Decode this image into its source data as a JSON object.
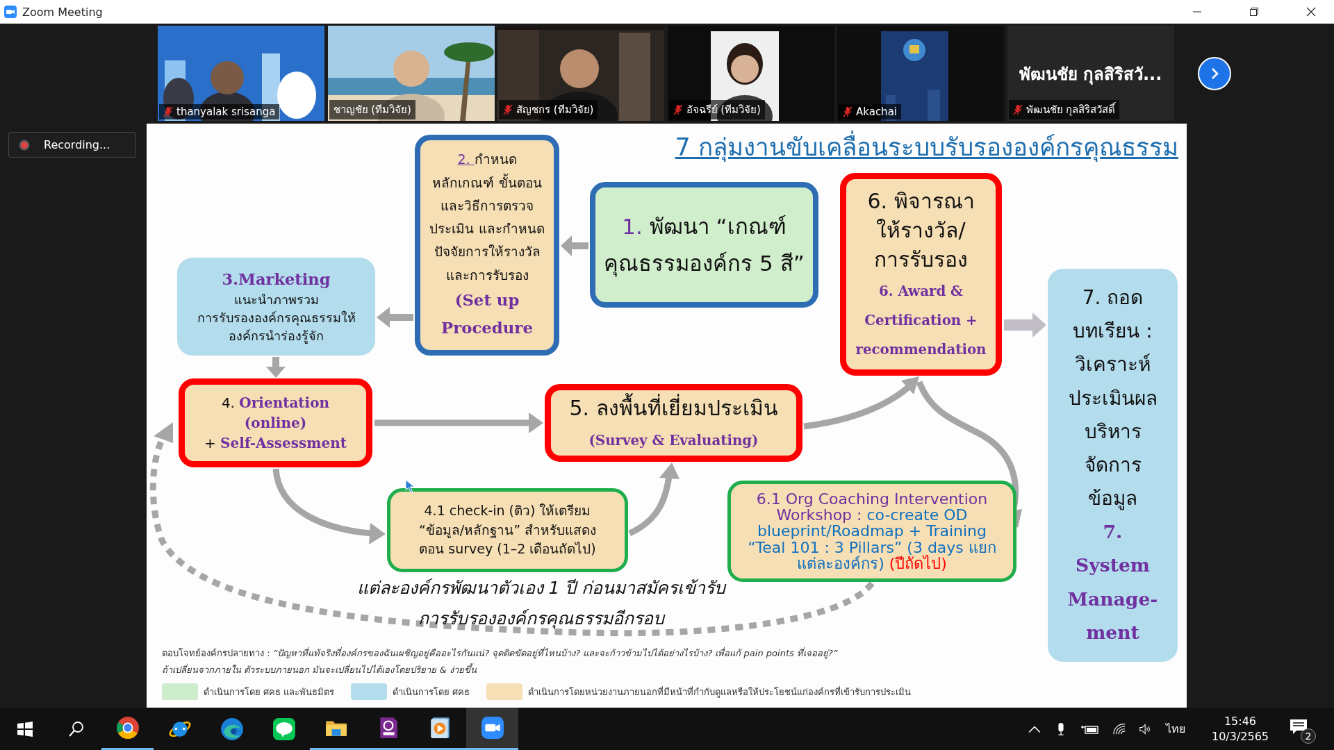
{
  "window": {
    "title": "Zoom Meeting"
  },
  "participants": [
    {
      "name": "thanyalak srisanga",
      "muted": true,
      "speaking": false,
      "kind": "video"
    },
    {
      "name": "ชาญชัย (ทีมวิจัย)",
      "muted": false,
      "speaking": true,
      "kind": "video"
    },
    {
      "name": "สัญชกร (ทีมวิจัย)",
      "muted": true,
      "speaking": false,
      "kind": "video"
    },
    {
      "name": "อัจฉรีย์ (ทีมวิจัย)",
      "muted": true,
      "speaking": false,
      "kind": "video"
    },
    {
      "name": "Akachai",
      "muted": true,
      "speaking": false,
      "kind": "video"
    },
    {
      "name": "พัฒนชัย กุลสิริสวัสดิ์",
      "display": "พัฒนชัย กุลสิริสวั...",
      "muted": true,
      "speaking": false,
      "kind": "name"
    }
  ],
  "recording": {
    "label": "Recording..."
  },
  "slide": {
    "title": "7 กลุ่มงานขับเคลื่อนระบบรับรององค์กรคุณธรรม",
    "nodes": [
      {
        "kind": "plan",
        "color": "#f6dfb4",
        "lines": [
          [
            {
              "text": "2. ",
              "kind": "link"
            },
            {
              "text": "กำหนด",
              "kind": "plain"
            }
          ],
          [
            {
              "text": "หลักเกณฑ์ ขั้นตอน",
              "kind": "plain"
            }
          ],
          [
            {
              "text": "และวิธีการตรวจ",
              "kind": "plain"
            }
          ],
          [
            {
              "text": "ประเมิน และกำหนด",
              "kind": "plain"
            }
          ],
          [
            {
              "text": "ปัจจัยการให้รางวัล",
              "kind": "plain"
            }
          ],
          [
            {
              "text": "และการรับรอง",
              "kind": "plain"
            }
          ],
          [
            {
              "text": "(Set up",
              "kind": "deco"
            }
          ],
          [
            {
              "text": "Procedure",
              "kind": "deco"
            }
          ]
        ]
      },
      {
        "kind": "plan",
        "color": "#d0eecb",
        "lines": [
          [
            {
              "text": "1. ",
              "kind": "num"
            },
            {
              "text": "พัฒนา “เกณฑ์",
              "kind": "plain"
            }
          ],
          [
            {
              "text": "คุณธรรมองค์กร 5 สี”",
              "kind": "plain"
            }
          ]
        ]
      },
      {
        "kind": "field",
        "color": "#f6dfb4",
        "lines": [
          [
            {
              "text": "6. พิจารณา",
              "kind": "plain"
            }
          ],
          [
            {
              "text": "ให้รางวัล/",
              "kind": "plain"
            }
          ],
          [
            {
              "text": "การรับรอง",
              "kind": "plain"
            }
          ],
          [
            {
              "text": "6. Award &",
              "kind": "deco"
            }
          ],
          [
            {
              "text": "Certification +",
              "kind": "deco"
            }
          ],
          [
            {
              "text": "recommendation",
              "kind": "deco"
            }
          ]
        ]
      },
      {
        "kind": "plain",
        "color": "#b3dced",
        "lines": [
          [
            {
              "text": "3.Marketing",
              "kind": "deco"
            }
          ],
          [
            {
              "text": "แนะนำภาพรวม",
              "kind": "plain"
            }
          ],
          [
            {
              "text": "การรับรององค์กรคุณธรรมให้",
              "kind": "plain"
            }
          ],
          [
            {
              "text": "องค์กรนำร่องรู้จัก",
              "kind": "plain"
            }
          ]
        ]
      },
      {
        "kind": "plain",
        "color": "#b3dced",
        "lines": [
          [
            {
              "text": "7. ถอด",
              "kind": "plain"
            }
          ],
          [
            {
              "text": "บทเรียน :",
              "kind": "plain"
            }
          ],
          [
            {
              "text": "วิเคราะห์",
              "kind": "plain"
            }
          ],
          [
            {
              "text": "ประเมินผล",
              "kind": "plain"
            }
          ],
          [
            {
              "text": "บริหาร",
              "kind": "plain"
            }
          ],
          [
            {
              "text": "จัดการ",
              "kind": "plain"
            }
          ],
          [
            {
              "text": "ข้อมูล",
              "kind": "plain"
            }
          ],
          [
            {
              "text": "7.",
              "kind": "deco"
            }
          ],
          [
            {
              "text": "System",
              "kind": "deco"
            }
          ],
          [
            {
              "text": "Manage-",
              "kind": "deco"
            }
          ],
          [
            {
              "text": "ment",
              "kind": "deco"
            }
          ]
        ]
      },
      {
        "kind": "field",
        "color": "#f6dfb4",
        "lines": [
          [
            {
              "text": "4. ",
              "kind": "plain"
            },
            {
              "text": "Orientation",
              "kind": "deco"
            }
          ],
          [
            {
              "text": "(online)",
              "kind": "deco"
            }
          ],
          [
            {
              "text": "+ ",
              "kind": "plain"
            },
            {
              "text": "Self-Assessment",
              "kind": "deco"
            }
          ]
        ]
      },
      {
        "kind": "field",
        "color": "#f6dfb4",
        "lines": [
          [
            {
              "text": "5. ลงพื้นที่เยี่ยมประเมิน",
              "kind": "plain"
            }
          ],
          [
            {
              "text": "(Survey & Evaluating)",
              "kind": "deco"
            }
          ]
        ]
      },
      {
        "kind": "support",
        "color": "#f6dfb4",
        "lines": [
          [
            {
              "text": "4.1 check-in (ติว) ให้เตรียม",
              "kind": "plain"
            }
          ],
          [
            {
              "text": "“ข้อมูล/หลักฐาน” สำหรับแสดง",
              "kind": "plain"
            }
          ],
          [
            {
              "text": "ตอน survey (1–2 เดือนถัดไป)",
              "kind": "plain"
            }
          ]
        ]
      },
      {
        "kind": "support",
        "color": "#f6dfb4",
        "lines": [
          [
            {
              "text": "6.1 Org Coaching Intervention",
              "kind": "accent"
            }
          ],
          [
            {
              "text": "Workshop : ",
              "kind": "accent"
            },
            {
              "text": "co-create OD",
              "kind": "blue"
            }
          ],
          [
            {
              "text": "blueprint/Roadmap + Training",
              "kind": "blue"
            }
          ],
          [
            {
              "text": "“Teal 101 : 3 Pillars” (3 days แยก",
              "kind": "blue"
            }
          ],
          [
            {
              "text": "แต่ละองค์กร) ",
              "kind": "blue"
            },
            {
              "text": "(ปีถัดไป)",
              "kind": "red"
            }
          ]
        ]
      }
    ],
    "caption": [
      "แต่ละองค์กรพัฒนาตัวเอง 1 ปี ก่อนมาสมัครเข้ารับ",
      "การรับรององค์กรคุณธรรมอีกรอบ"
    ],
    "footnote": [
      "ตอบโจทย์องค์กรปลายทาง : *“ปัญหาที่แท้จริงที่องค์กรของฉันเผชิญอยู่คืออะไรกันแน่? จุดติดขัดอยู่ที่ไหนบ้าง? และจะก้าวข้ามไปได้อย่างไรบ้าง? เพื่อแก้ pain points ที่เจออยู่?”*",
      "*ถ้าเปลี่ยนจากภายใน ตัวระบบภายนอก มันจะเปลี่ยนไปได้เองโดยปริยาย & ง่ายขึ้น*"
    ],
    "legend": [
      {
        "color": "#cdeccb",
        "label": "ดำเนินการโดย ศคธ และพันธมิตร"
      },
      {
        "color": "#b3dced",
        "label": "ดำเนินการโดย ศคธ"
      },
      {
        "color": "#f6dfb4",
        "label": "ดำเนินการโดยหน่วยงานภายนอกที่มีหน้าที่กำกับดูแลหรือให้ประโยชน์แก่องค์กรที่เข้ารับการประเมิน"
      }
    ]
  },
  "taskbar": {
    "apps": [
      {
        "kind": "chrome",
        "running": true,
        "selected": false
      },
      {
        "kind": "ie",
        "running": false,
        "selected": false
      },
      {
        "kind": "edge",
        "running": false,
        "selected": false
      },
      {
        "kind": "line",
        "running": false,
        "selected": false
      },
      {
        "kind": "files",
        "running": true,
        "selected": false
      },
      {
        "kind": "pdf",
        "running": true,
        "selected": false
      },
      {
        "kind": "media",
        "running": true,
        "selected": false
      },
      {
        "kind": "zoom",
        "running": true,
        "selected": true
      }
    ],
    "language": "ไทย",
    "time": "15:46",
    "date": "10/3/2565",
    "notifications": "2"
  }
}
